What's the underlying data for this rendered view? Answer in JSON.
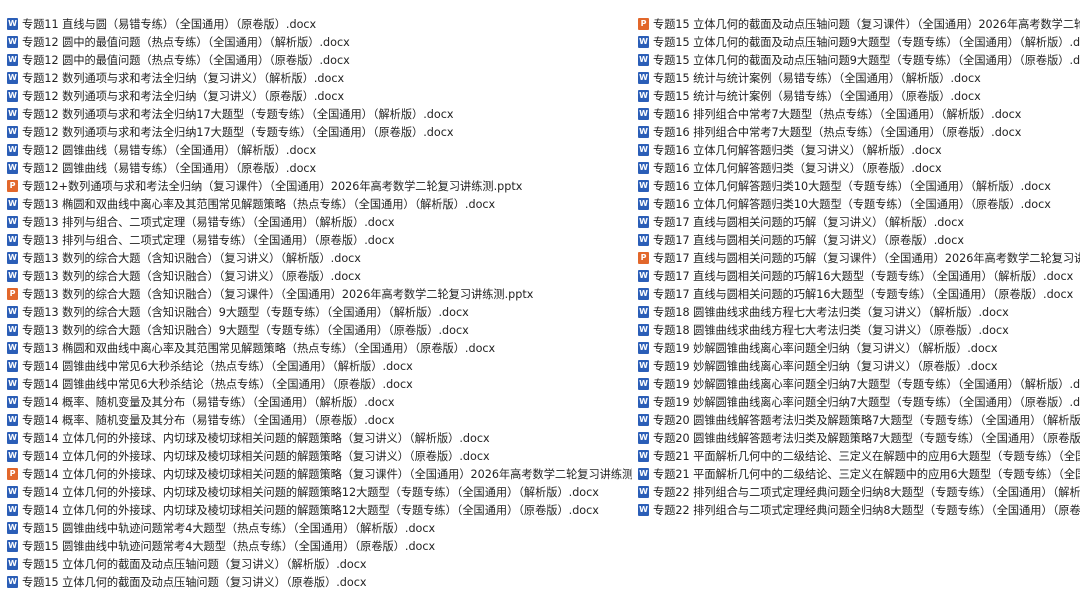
{
  "icons": {
    "docx": "word-doc-icon",
    "pptx": "powerpoint-icon"
  },
  "colors": {
    "docx_icon": "#2b5eb7",
    "pptx_icon": "#e2672b"
  },
  "left_files": [
    {
      "type": "docx",
      "name": "专题11 直线与圆（易错专练）（全国通用）（原卷版）.docx"
    },
    {
      "type": "docx",
      "name": "专题12  圆中的最值问题（热点专练）（全国通用）（解析版）.docx"
    },
    {
      "type": "docx",
      "name": "专题12  圆中的最值问题（热点专练）（全国通用）（原卷版）.docx"
    },
    {
      "type": "docx",
      "name": "专题12 数列通项与求和考法全归纳（复习讲义）（解析版）.docx"
    },
    {
      "type": "docx",
      "name": "专题12 数列通项与求和考法全归纳（复习讲义）（原卷版）.docx"
    },
    {
      "type": "docx",
      "name": "专题12 数列通项与求和考法全归纳17大题型（专题专练）（全国通用）（解析版）.docx"
    },
    {
      "type": "docx",
      "name": "专题12 数列通项与求和考法全归纳17大题型（专题专练）（全国通用）（原卷版）.docx"
    },
    {
      "type": "docx",
      "name": "专题12 圆锥曲线（易错专练）（全国通用）（解析版）.docx"
    },
    {
      "type": "docx",
      "name": "专题12 圆锥曲线（易错专练）（全国通用）（原卷版）.docx"
    },
    {
      "type": "pptx",
      "name": "专题12+数列通项与求和考法全归纳（复习课件）（全国通用）2026年高考数学二轮复习讲练测.pptx"
    },
    {
      "type": "docx",
      "name": "专题13  椭圆和双曲线中离心率及其范围常见解题策略（热点专练）（全国通用）（解析版）.docx"
    },
    {
      "type": "docx",
      "name": "专题13 排列与组合、二项式定理（易错专练）（全国通用）（解析版）.docx"
    },
    {
      "type": "docx",
      "name": "专题13 排列与组合、二项式定理（易错专练）（全国通用）（原卷版）.docx"
    },
    {
      "type": "docx",
      "name": "专题13 数列的综合大题（含知识融合）（复习讲义）（解析版）.docx"
    },
    {
      "type": "docx",
      "name": "专题13 数列的综合大题（含知识融合）（复习讲义）（原卷版）.docx"
    },
    {
      "type": "pptx",
      "name": "专题13 数列的综合大题（含知识融合）（复习课件）（全国通用）2026年高考数学二轮复习讲练测.pptx"
    },
    {
      "type": "docx",
      "name": "专题13 数列的综合大题（含知识融合）9大题型（专题专练）（全国通用）（解析版）.docx"
    },
    {
      "type": "docx",
      "name": "专题13 数列的综合大题（含知识融合）9大题型（专题专练）（全国通用）（原卷版）.docx"
    },
    {
      "type": "docx",
      "name": "专题13 椭圆和双曲线中离心率及其范围常见解题策略（热点专练）（全国通用）（原卷版）.docx"
    },
    {
      "type": "docx",
      "name": "专题14  圆锥曲线中常见6大秒杀结论（热点专练）（全国通用）（解析版）.docx"
    },
    {
      "type": "docx",
      "name": "专题14  圆锥曲线中常见6大秒杀结论（热点专练）（全国通用）（原卷版）.docx"
    },
    {
      "type": "docx",
      "name": "专题14 概率、随机变量及其分布（易错专练）（全国通用）（解析版）.docx"
    },
    {
      "type": "docx",
      "name": "专题14 概率、随机变量及其分布（易错专练）（全国通用）（原卷版）.docx"
    },
    {
      "type": "docx",
      "name": "专题14 立体几何的外接球、内切球及棱切球相关问题的解题策略（复习讲义）（解析版）.docx"
    },
    {
      "type": "docx",
      "name": "专题14 立体几何的外接球、内切球及棱切球相关问题的解题策略（复习讲义）（原卷版）.docx"
    },
    {
      "type": "pptx",
      "name": "专题14 立体几何的外接球、内切球及棱切球相关问题的解题策略（复习课件）（全国通用）2026年高考数学二轮复习讲练测.pptx"
    },
    {
      "type": "docx",
      "name": "专题14 立体几何的外接球、内切球及棱切球相关问题的解题策略12大题型（专题专练）（全国通用）（解析版）.docx"
    },
    {
      "type": "docx",
      "name": "专题14 立体几何的外接球、内切球及棱切球相关问题的解题策略12大题型（专题专练）（全国通用）（原卷版）.docx"
    },
    {
      "type": "docx",
      "name": "专题15  圆锥曲线中轨迹问题常考4大题型（热点专练）（全国通用）（解析版）.docx"
    },
    {
      "type": "docx",
      "name": "专题15  圆锥曲线中轨迹问题常考4大题型（热点专练）（全国通用）（原卷版）.docx"
    },
    {
      "type": "docx",
      "name": "专题15 立体几何的截面及动点压轴问题（复习讲义）（解析版）.docx"
    },
    {
      "type": "docx",
      "name": "专题15 立体几何的截面及动点压轴问题（复习讲义）（原卷版）.docx"
    }
  ],
  "right_files": [
    {
      "type": "pptx",
      "name": "专题15 立体几何的截面及动点压轴问题（复习课件）（全国通用）2026年高考数学二轮复习讲"
    },
    {
      "type": "docx",
      "name": "专题15 立体几何的截面及动点压轴问题9大题型（专题专练）（全国通用）（解析版）.docx"
    },
    {
      "type": "docx",
      "name": "专题15 立体几何的截面及动点压轴问题9大题型（专题专练）（全国通用）（原卷版）.docx"
    },
    {
      "type": "docx",
      "name": "专题15 统计与统计案例（易错专练）（全国通用）（解析版）.docx"
    },
    {
      "type": "docx",
      "name": "专题15 统计与统计案例（易错专练）（全国通用）（原卷版）.docx"
    },
    {
      "type": "docx",
      "name": "专题16  排列组合中常考7大题型（热点专练）（全国通用）（解析版）.docx"
    },
    {
      "type": "docx",
      "name": "专题16  排列组合中常考7大题型（热点专练）（全国通用）（原卷版）.docx"
    },
    {
      "type": "docx",
      "name": "专题16 立体几何解答题归类（复习讲义）（解析版）.docx"
    },
    {
      "type": "docx",
      "name": "专题16 立体几何解答题归类（复习讲义）（原卷版）.docx"
    },
    {
      "type": "docx",
      "name": "专题16 立体几何解答题归类10大题型（专题专练）（全国通用）（解析版）.docx"
    },
    {
      "type": "docx",
      "name": "专题16 立体几何解答题归类10大题型（专题专练）（全国通用）（原卷版）.docx"
    },
    {
      "type": "docx",
      "name": "专题17 直线与圆相关问题的巧解（复习讲义）（解析版）.docx"
    },
    {
      "type": "docx",
      "name": "专题17 直线与圆相关问题的巧解（复习讲义）（原卷版）.docx"
    },
    {
      "type": "pptx",
      "name": "专题17 直线与圆相关问题的巧解（复习课件）（全国通用）2026年高考数学二轮复习讲练测."
    },
    {
      "type": "docx",
      "name": "专题17 直线与圆相关问题的巧解16大题型（专题专练）（全国通用）（解析版）.docx"
    },
    {
      "type": "docx",
      "name": "专题17 直线与圆相关问题的巧解16大题型（专题专练）（全国通用）（原卷版）.docx"
    },
    {
      "type": "docx",
      "name": "专题18 圆锥曲线求曲线方程七大考法归类（复习讲义）（解析版）.docx"
    },
    {
      "type": "docx",
      "name": "专题18 圆锥曲线求曲线方程七大考法归类（复习讲义）（原卷版）.docx"
    },
    {
      "type": "docx",
      "name": "专题19 妙解圆锥曲线离心率问题全归纳（复习讲义）（解析版）.docx"
    },
    {
      "type": "docx",
      "name": "专题19 妙解圆锥曲线离心率问题全归纳（复习讲义）（原卷版）.docx"
    },
    {
      "type": "docx",
      "name": "专题19 妙解圆锥曲线离心率问题全归纳7大题型（专题专练）（全国通用）（解析版）.docx"
    },
    {
      "type": "docx",
      "name": "专题19 妙解圆锥曲线离心率问题全归纳7大题型（专题专练）（全国通用）（原卷版）.docx"
    },
    {
      "type": "docx",
      "name": "专题20 圆锥曲线解答题考法归类及解题策略7大题型（专题专练）（全国通用）（解析版）.d"
    },
    {
      "type": "docx",
      "name": "专题20 圆锥曲线解答题考法归类及解题策略7大题型（专题专练）（全国通用）（原卷版）.d"
    },
    {
      "type": "docx",
      "name": "专题21 平面解析几何中的二级结论、三定义在解题中的应用6大题型（专题专练）（全国通"
    },
    {
      "type": "docx",
      "name": "专题21 平面解析几何中的二级结论、三定义在解题中的应用6大题型（专题专练）（全国通用"
    },
    {
      "type": "docx",
      "name": "专题22 排列组合与二项式定理经典问题全归纳8大题型（专题专练）（全国通用）（解析版）"
    },
    {
      "type": "docx",
      "name": "专题22 排列组合与二项式定理经典问题全归纳8大题型（专题专练）（全国通用）（原卷版）"
    }
  ]
}
